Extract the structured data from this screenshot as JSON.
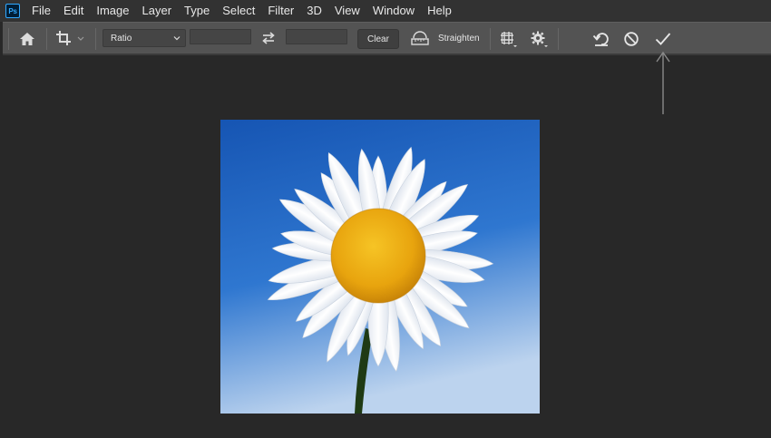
{
  "app": {
    "logo_text": "Ps"
  },
  "menubar": {
    "items": [
      "File",
      "Edit",
      "Image",
      "Layer",
      "Type",
      "Select",
      "Filter",
      "3D",
      "View",
      "Window",
      "Help"
    ]
  },
  "options_bar": {
    "home_icon": "home-icon",
    "crop_tool_icon": "crop-icon",
    "ratio": {
      "selected": "Ratio"
    },
    "width_value": "",
    "height_value": "",
    "swap_icon": "swap-arrows-icon",
    "clear_label": "Clear",
    "straighten_label": "Straighten",
    "overlay_icon": "grid-icon",
    "settings_icon": "gear-icon",
    "reset_icon": "reset-icon",
    "cancel_icon": "cancel-icon",
    "commit_icon": "checkmark-icon"
  },
  "colors": {
    "menubar_bg": "#323232",
    "options_bg": "#535353",
    "canvas_bg": "#282828",
    "ps_blue": "#31a8ff",
    "sky": "#1c63c2",
    "petal": "#f4f6fa",
    "center": "#f2b417"
  },
  "canvas": {
    "image": "daisy-photo"
  }
}
